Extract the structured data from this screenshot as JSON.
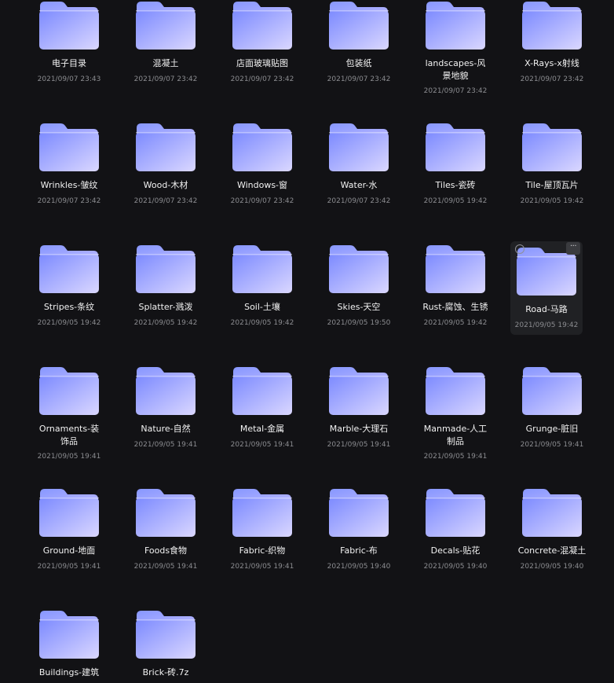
{
  "folders": [
    {
      "name": "电子目录",
      "date": "2021/09/07 23:43"
    },
    {
      "name": "混凝土",
      "date": "2021/09/07 23:42"
    },
    {
      "name": "店面玻璃贴图",
      "date": "2021/09/07 23:42"
    },
    {
      "name": "包装纸",
      "date": "2021/09/07 23:42"
    },
    {
      "name": "landscapes-风景地貌",
      "date": "2021/09/07 23:42"
    },
    {
      "name": "X-Rays-x射线",
      "date": "2021/09/07 23:42"
    },
    {
      "name": "Wrinkles-皱纹",
      "date": "2021/09/07 23:42"
    },
    {
      "name": "Wood-木材",
      "date": "2021/09/07 23:42"
    },
    {
      "name": "Windows-窗",
      "date": "2021/09/07 23:42"
    },
    {
      "name": "Water-水",
      "date": "2021/09/07 23:42"
    },
    {
      "name": "Tiles-瓷砖",
      "date": "2021/09/05 19:42"
    },
    {
      "name": "Tile-屋顶瓦片",
      "date": "2021/09/05 19:42"
    },
    {
      "name": "Stripes-条纹",
      "date": "2021/09/05 19:42"
    },
    {
      "name": "Splatter-溅泼",
      "date": "2021/09/05 19:42"
    },
    {
      "name": "Soil-土壤",
      "date": "2021/09/05 19:42"
    },
    {
      "name": "Skies-天空",
      "date": "2021/09/05 19:50"
    },
    {
      "name": "Rust-腐蚀、生锈",
      "date": "2021/09/05 19:42"
    },
    {
      "name": "Road-马路",
      "date": "2021/09/05 19:42"
    },
    {
      "name": "Ornaments-装饰品",
      "date": "2021/09/05 19:41"
    },
    {
      "name": "Nature-自然",
      "date": "2021/09/05 19:41"
    },
    {
      "name": "Metal-金属",
      "date": "2021/09/05 19:41"
    },
    {
      "name": "Marble-大理石",
      "date": "2021/09/05 19:41"
    },
    {
      "name": "Manmade-人工制品",
      "date": "2021/09/05 19:41"
    },
    {
      "name": "Grunge-脏旧",
      "date": "2021/09/05 19:41"
    },
    {
      "name": "Ground-地面",
      "date": "2021/09/05 19:41"
    },
    {
      "name": "Foods食物",
      "date": "2021/09/05 19:41"
    },
    {
      "name": "Fabric-织物",
      "date": "2021/09/05 19:41"
    },
    {
      "name": "Fabric-布",
      "date": "2021/09/05 19:40"
    },
    {
      "name": "Decals-贴花",
      "date": "2021/09/05 19:40"
    },
    {
      "name": "Concrete-混凝土",
      "date": "2021/09/05 19:40"
    },
    {
      "name": "Buildings-建筑",
      "date": ""
    },
    {
      "name": "Brick-砖.7z",
      "date": ""
    }
  ],
  "hovered_item": {
    "index": 17,
    "more_label": "···"
  },
  "icons": {
    "folder": "folder-icon",
    "select": "select-circle-icon",
    "more": "more-options-icon"
  },
  "colors": {
    "background": "#121215",
    "folder_gradient_start": "#7f8dff",
    "folder_gradient_end": "#d9d6ff",
    "text": "#f2f2f2",
    "date": "#8b8c90"
  }
}
